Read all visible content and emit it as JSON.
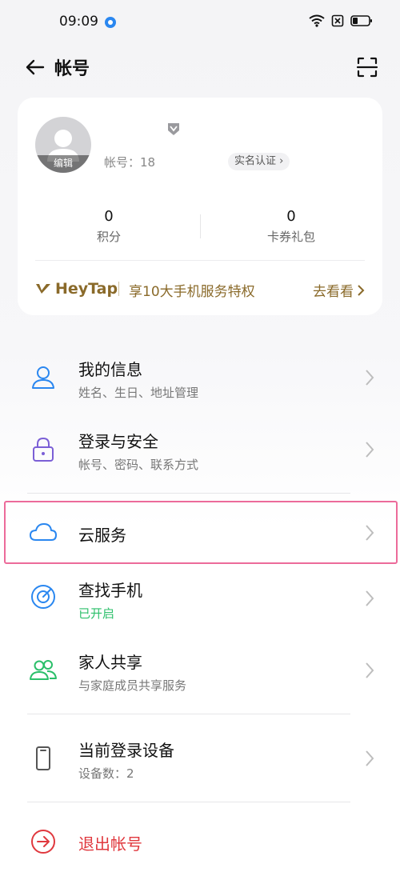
{
  "status_bar": {
    "time": "09:09"
  },
  "header": {
    "title": "帐号"
  },
  "profile": {
    "avatar_edit": "编辑",
    "account_label": "帐号：18",
    "verify": "实名认证",
    "stats": [
      {
        "value": "0",
        "label": "积分"
      },
      {
        "value": "0",
        "label": "卡券礼包"
      }
    ],
    "heytap": {
      "brand": "HeyTap",
      "promo": "享10大手机服务特权",
      "action": "去看看"
    }
  },
  "menu": {
    "my_info": {
      "title": "我的信息",
      "subtitle": "姓名、生日、地址管理"
    },
    "login_security": {
      "title": "登录与安全",
      "subtitle": "帐号、密码、联系方式"
    },
    "cloud": {
      "title": "云服务"
    },
    "find_phone": {
      "title": "查找手机",
      "subtitle": "已开启"
    },
    "family": {
      "title": "家人共享",
      "subtitle": "与家庭成员共享服务"
    },
    "devices": {
      "title": "当前登录设备",
      "subtitle": "设备数：2"
    },
    "logout": {
      "title": "退出帐号"
    }
  },
  "colors": {
    "accent_blue": "#2a87f0",
    "purple": "#7b5fd6",
    "green_on": "#2bbf6a",
    "logout_red": "#e0383e",
    "heytap_gold": "#8a6a2a",
    "highlight_pink": "#ec6b9a"
  }
}
